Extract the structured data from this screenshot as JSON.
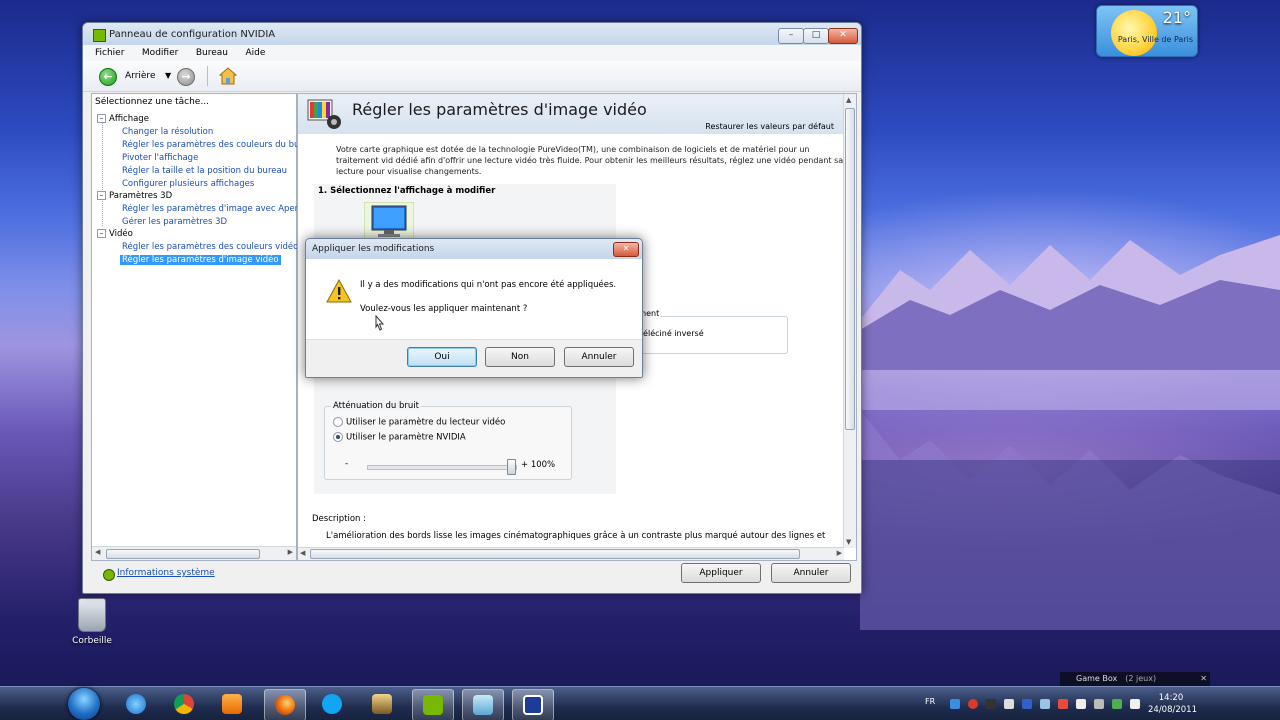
{
  "weather": {
    "temperature": "21°",
    "city": "Paris, Ville de Paris"
  },
  "desktop": {
    "recycle_bin": "Corbeille"
  },
  "window": {
    "title": "Panneau de configuration NVIDIA",
    "menu": [
      "Fichier",
      "Modifier",
      "Bureau",
      "Aide"
    ],
    "toolbar": {
      "back_label": "Arrière"
    },
    "task_pane_title": "Sélectionnez une tâche...",
    "tree": {
      "affichage": {
        "label": "Affichage",
        "items": [
          "Changer la résolution",
          "Régler les paramètres des couleurs du bure",
          "Pivoter l'affichage",
          "Régler la taille et la position du bureau",
          "Configurer plusieurs affichages"
        ]
      },
      "param3d": {
        "label": "Paramètres 3D",
        "items": [
          "Régler les paramètres d'image avec Aperçu",
          "Gérer les paramètres 3D"
        ]
      },
      "video": {
        "label": "Vidéo",
        "items": [
          "Régler les paramètres des couleurs vidéo",
          "Régler les paramètres d'image vidéo"
        ]
      }
    },
    "content": {
      "title": "Régler les paramètres d'image vidéo",
      "restore_defaults": "Restaurer les valeurs par défaut",
      "intro": "Votre carte graphique est dotée de la technologie PureVideo(TM), une combinaison de logiciels et de matériel pour un traitement vid dédié afin d'offrir une lecture vidéo très fluide. Pour obtenir les meilleurs résultats, réglez une vidéo pendant sa lecture pour visualise changements.",
      "step1": "1. Sélectionnez l'affichage à modifier",
      "side_group_legend": "cement",
      "side_group_option": "ser téléciné inversé",
      "noise": {
        "legend": "Atténuation du bruit",
        "option1": "Utiliser le paramètre du lecteur vidéo",
        "option2": "Utiliser le paramètre NVIDIA",
        "selected": 2,
        "slider_minus": "-",
        "slider_value_label": "+ 100%",
        "slider_fraction": 0.97
      },
      "description_label": "Description :",
      "description_text": "L'amélioration des bords lisse les images cinématographiques grâce à un contraste plus marqué autour des lignes et"
    },
    "system_info_link": "Informations système",
    "apply_button": "Appliquer",
    "cancel_button": "Annuler"
  },
  "dialog": {
    "title": "Appliquer les modifications",
    "message1": "Il y a des modifications qui n'ont pas encore été appliquées.",
    "message2": "Voulez-vous les appliquer maintenant ?",
    "buttons": {
      "yes": "Oui",
      "no": "Non",
      "cancel": "Annuler"
    }
  },
  "taskbar": {
    "language": "FR",
    "time": "14:20",
    "date": "24/08/2011",
    "gamebox_label": "Game Box",
    "gamebox_count": "(2 jeux)"
  },
  "colors": {
    "nvidia_green": "#76b900",
    "selection_blue": "#3399ff",
    "link_blue": "#1a4fb5"
  }
}
